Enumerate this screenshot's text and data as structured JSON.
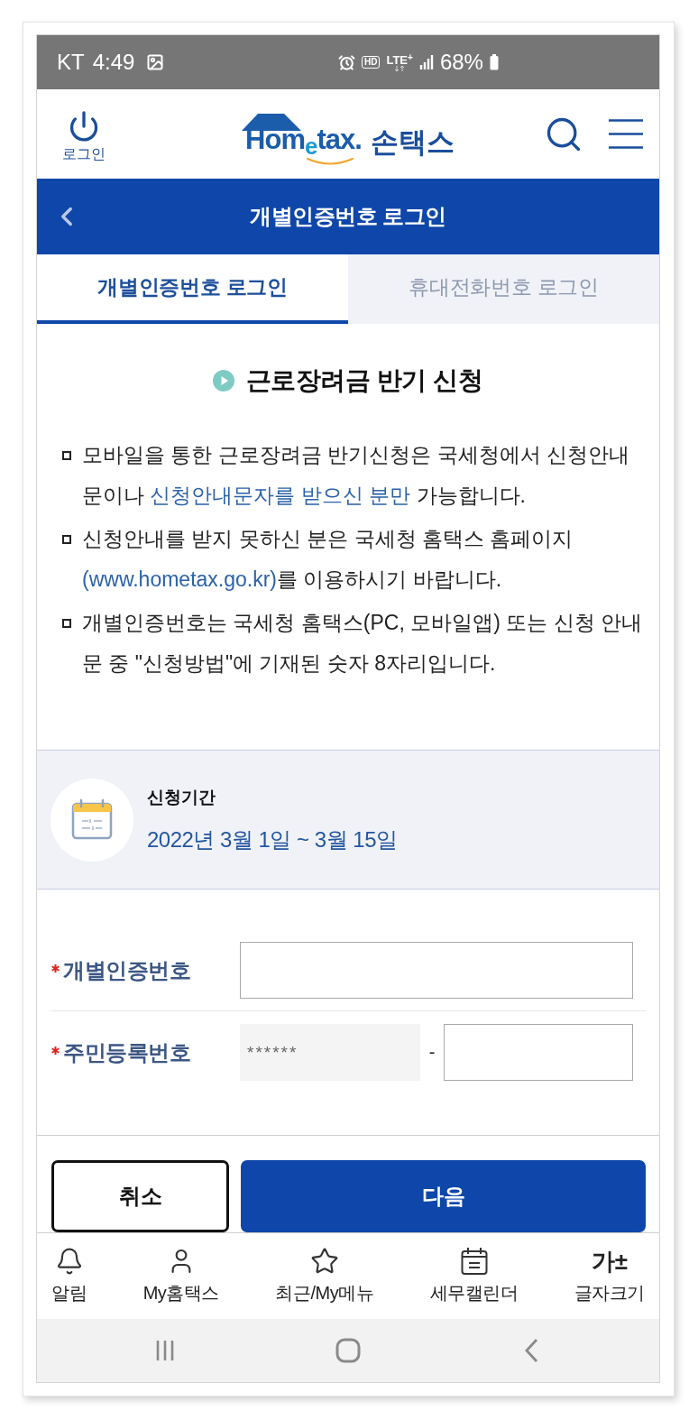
{
  "status_bar": {
    "carrier": "KT",
    "time": "4:49",
    "hd_badge": "HD",
    "network": "LTE$^{+}$",
    "battery": "68%"
  },
  "header": {
    "login_label": "로그인",
    "logo_text": "Hom$_{e}$tax.",
    "app_name": "손택스"
  },
  "title_bar": {
    "title": "개별인증번호 로그인"
  },
  "tabs": [
    {
      "label": "개별인증번호 로그인",
      "selected": true
    },
    {
      "label": "휴대전화번호 로그인",
      "selected": false
    }
  ],
  "notice": {
    "title": "근로장려금 반기 신청",
    "items": [
      {
        "segments": [
          {
            "kind": "text",
            "text": "모바일을 통한 근로장려금 반기신청은 국세청에서 신청안내문이나 "
          },
          {
            "kind": "emphasis",
            "text": "신청안내문자를 받으신 분만"
          },
          {
            "kind": "text",
            "text": " 가능합니다."
          }
        ]
      },
      {
        "segments": [
          {
            "kind": "text",
            "text": "신청안내를 받지 못하신 분은 국세청 홈택스 홈페이지 "
          },
          {
            "kind": "link",
            "text": "(www.hometax.go.kr)"
          },
          {
            "kind": "text",
            "text": "를 이용하시기 바랍니다."
          }
        ]
      },
      {
        "segments": [
          {
            "kind": "text",
            "text": "개별인증번호는 국세청 홈택스(PC, 모바일앱) 또는 신청 안내문 중 \"신청방법\"에 기재된 숫자 8자리입니다."
          }
        ]
      }
    ]
  },
  "period": {
    "label": "신청기간",
    "value": "2022년 3월 1일 ~ 3월 15일"
  },
  "form": {
    "fields": [
      {
        "label": "개별인증번호",
        "required": true,
        "inputs": [
          {
            "readonly": false
          }
        ]
      },
      {
        "label": "주민등록번호",
        "required": true,
        "separator": "-",
        "inputs": [
          {
            "readonly": true,
            "value": "******"
          },
          {
            "readonly": false
          }
        ]
      }
    ]
  },
  "buttons": [
    {
      "label": "취소",
      "kind": "secondary"
    },
    {
      "label": "다음",
      "kind": "primary"
    }
  ],
  "bottom_nav": [
    {
      "label": "알림",
      "kind": "icon"
    },
    {
      "label": "My홈택스",
      "kind": "icon"
    },
    {
      "label": "최근/My메뉴",
      "kind": "icon"
    },
    {
      "label": "세무캘린더",
      "kind": "icon"
    },
    {
      "label": "글자크기",
      "kind": "glyph",
      "glyph": "가±"
    }
  ]
}
